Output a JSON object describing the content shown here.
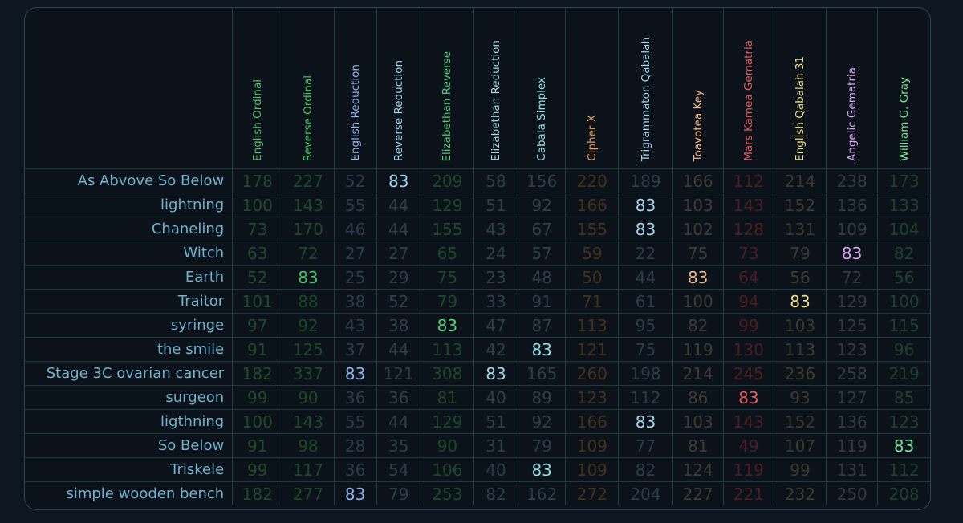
{
  "ciphers": [
    {
      "name": "English Ordinal",
      "color": "#4fc06c",
      "dim": "#1f4a2c"
    },
    {
      "name": "Reverse Ordinal",
      "color": "#46c46a",
      "dim": "#1d472a"
    },
    {
      "name": "English Reduction",
      "color": "#8cb3ee",
      "dim": "#2c3a4c"
    },
    {
      "name": "Reverse Reduction",
      "color": "#9ad6ee",
      "dim": "#2d3e48"
    },
    {
      "name": "Elizabethan Reverse",
      "color": "#4fd07a",
      "dim": "#1d472a"
    },
    {
      "name": "Elizabethan Reduction",
      "color": "#a4d8e6",
      "dim": "#2e3e48"
    },
    {
      "name": "Cabala Simplex",
      "color": "#8ee0e8",
      "dim": "#2c3e48"
    },
    {
      "name": "Cipher X",
      "color": "#e6a05a",
      "dim": "#43311d"
    },
    {
      "name": "Trigrammaton Qabalah",
      "color": "#a7d6f0",
      "dim": "#2c3c48"
    },
    {
      "name": "Toavotea Key",
      "color": "#eab488",
      "dim": "#3e3a36"
    },
    {
      "name": "Mars Kamea Gematria",
      "color": "#e85a5a",
      "dim": "#4a1d24"
    },
    {
      "name": "English Qabalah 31",
      "color": "#eedf8a",
      "dim": "#3c3a2e"
    },
    {
      "name": "Angelic Gematria",
      "color": "#d8a6ee",
      "dim": "#343844"
    },
    {
      "name": "William G. Gray",
      "color": "#6ee49a",
      "dim": "#1e4030"
    }
  ],
  "rows": [
    {
      "label": "As Abvove So Below",
      "values": [
        178,
        227,
        52,
        83,
        209,
        58,
        156,
        220,
        189,
        166,
        112,
        214,
        238,
        173
      ]
    },
    {
      "label": "lightning",
      "values": [
        100,
        143,
        55,
        44,
        129,
        51,
        92,
        166,
        83,
        103,
        143,
        152,
        136,
        133
      ]
    },
    {
      "label": "Chaneling",
      "values": [
        73,
        170,
        46,
        44,
        155,
        43,
        67,
        155,
        83,
        102,
        128,
        131,
        109,
        104
      ]
    },
    {
      "label": "Witch",
      "values": [
        63,
        72,
        27,
        27,
        65,
        24,
        57,
        59,
        22,
        75,
        73,
        79,
        83,
        82
      ]
    },
    {
      "label": "Earth",
      "values": [
        52,
        83,
        25,
        29,
        75,
        23,
        48,
        50,
        44,
        83,
        64,
        56,
        72,
        56
      ]
    },
    {
      "label": "Traitor",
      "values": [
        101,
        88,
        38,
        52,
        79,
        33,
        91,
        71,
        61,
        100,
        94,
        83,
        129,
        100
      ]
    },
    {
      "label": "syringe",
      "values": [
        97,
        92,
        43,
        38,
        83,
        47,
        87,
        113,
        95,
        82,
        99,
        103,
        125,
        115
      ]
    },
    {
      "label": "the smile",
      "values": [
        91,
        125,
        37,
        44,
        113,
        42,
        83,
        121,
        75,
        119,
        130,
        113,
        123,
        96
      ]
    },
    {
      "label": "Stage 3C ovarian cancer",
      "values": [
        182,
        337,
        83,
        121,
        308,
        83,
        165,
        260,
        198,
        214,
        245,
        236,
        258,
        219
      ]
    },
    {
      "label": "surgeon",
      "values": [
        99,
        90,
        36,
        36,
        81,
        40,
        89,
        123,
        112,
        86,
        83,
        93,
        127,
        85
      ]
    },
    {
      "label": "ligthning",
      "values": [
        100,
        143,
        55,
        44,
        129,
        51,
        92,
        166,
        83,
        103,
        143,
        152,
        136,
        123
      ]
    },
    {
      "label": "So Below",
      "values": [
        91,
        98,
        28,
        35,
        90,
        31,
        79,
        109,
        77,
        81,
        49,
        107,
        119,
        83
      ]
    },
    {
      "label": "Triskele",
      "values": [
        99,
        117,
        36,
        54,
        106,
        40,
        83,
        109,
        82,
        124,
        119,
        99,
        131,
        112
      ]
    },
    {
      "label": "simple wooden bench",
      "values": [
        182,
        277,
        83,
        79,
        253,
        82,
        162,
        272,
        204,
        227,
        221,
        232,
        250,
        208
      ]
    }
  ],
  "highlight_value": 83
}
